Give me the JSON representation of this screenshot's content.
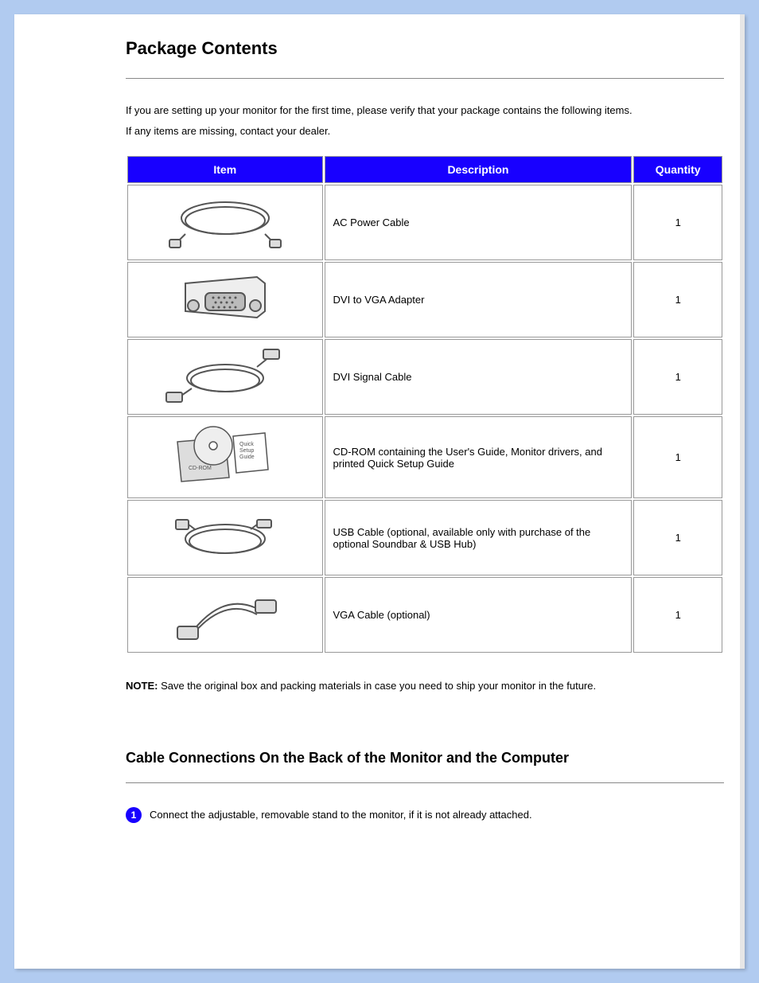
{
  "section1": {
    "title": "Package Contents",
    "intro1": "If you are setting up your monitor for the first time, please verify that your package contains the following items.",
    "intro2": "If any items are missing, contact your dealer.",
    "table": {
      "headers": {
        "item": "Item",
        "desc": "Description",
        "qty": "Quantity"
      },
      "rows": [
        {
          "desc": "AC Power Cable",
          "qty": "1"
        },
        {
          "desc": "DVI to VGA Adapter",
          "qty": "1"
        },
        {
          "desc": "DVI Signal Cable",
          "qty": "1"
        },
        {
          "desc": "CD-ROM containing the User's Guide, Monitor drivers, and printed Quick Setup Guide",
          "qty": "1"
        },
        {
          "desc": "USB Cable (optional, available only with purchase of the optional Soundbar & USB Hub)",
          "qty": "1"
        },
        {
          "desc": "VGA Cable (optional)",
          "qty": "1"
        }
      ]
    },
    "note_label": "NOTE:",
    "note_body": " Save the original box and packing materials in case you need to ship your monitor in the future."
  },
  "section2": {
    "title": "Cable Connections On the Back of the Monitor and the Computer",
    "step_num": "1",
    "step_text": "Connect the adjustable, removable stand to the monitor, if it is not already attached."
  }
}
